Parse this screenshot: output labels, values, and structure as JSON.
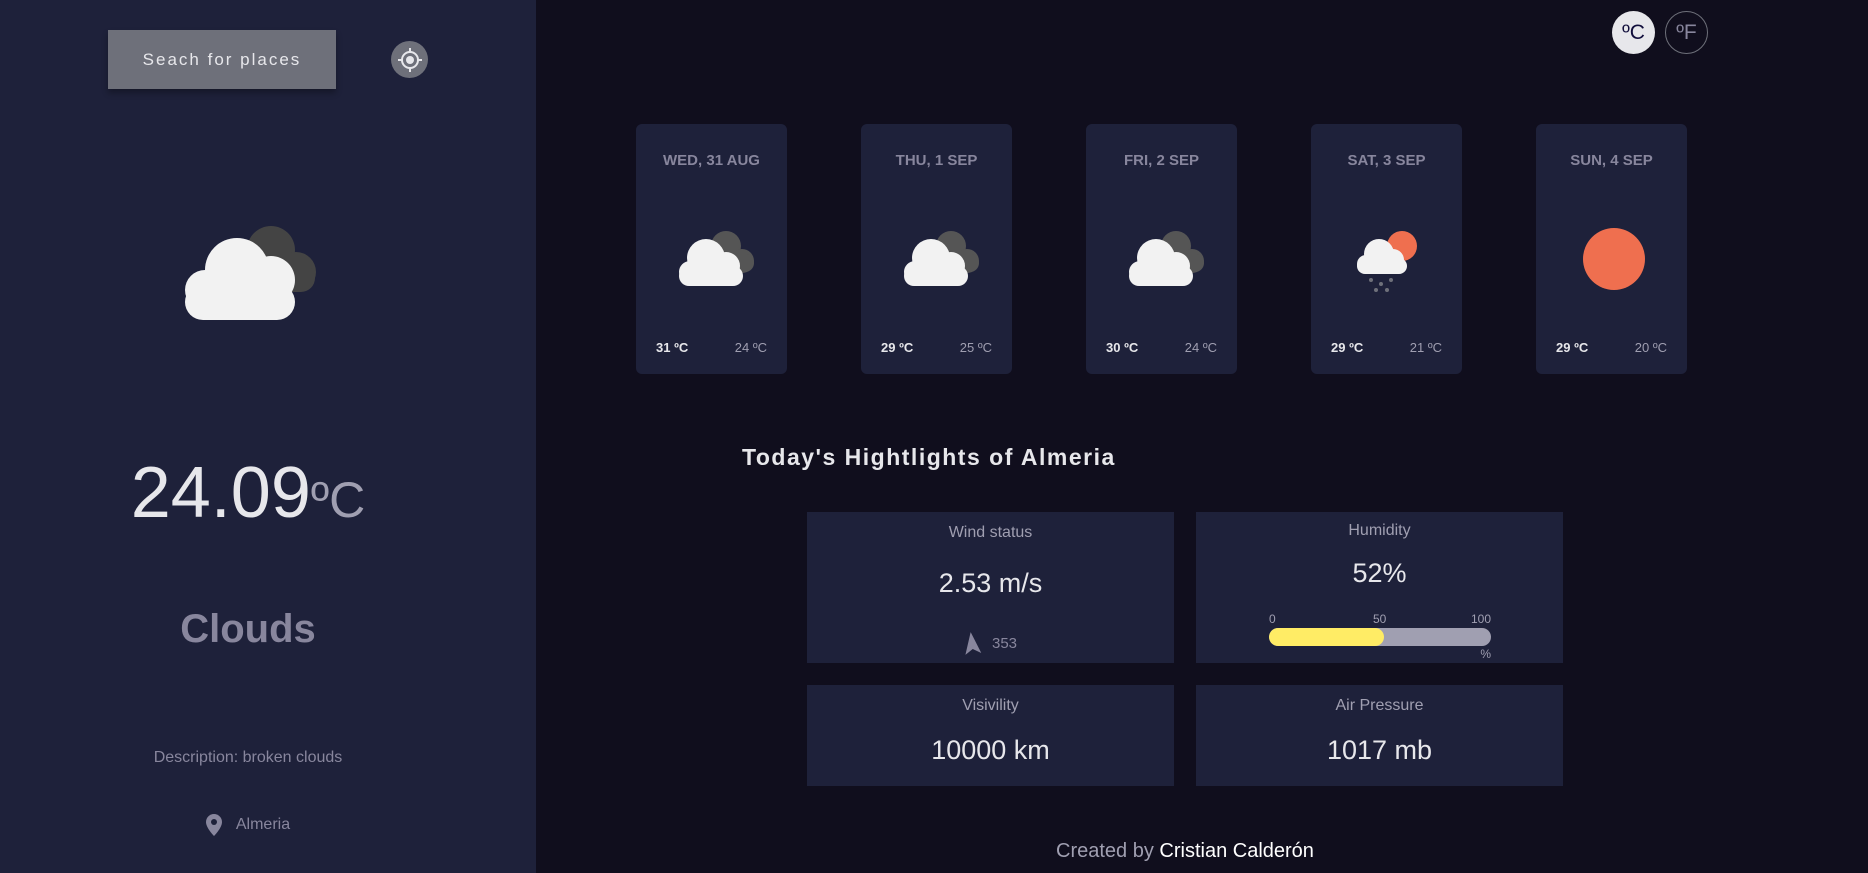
{
  "sidebar": {
    "search_label": "Seach for places",
    "main_icon": "cloud-icon",
    "temp_value": "24.09",
    "temp_unit": "ºC",
    "condition": "Clouds",
    "description": "Description: broken clouds",
    "location": "Almeria"
  },
  "units": {
    "celsius": "ºC",
    "fahrenheit": "ºF",
    "selected": "celsius"
  },
  "forecast": [
    {
      "date": "WED, 31 AUG",
      "icon": "cloud-icon",
      "max": "31 ºC",
      "min": "24 ºC"
    },
    {
      "date": "THU, 1 SEP",
      "icon": "cloud-icon",
      "max": "29 ºC",
      "min": "25 ºC"
    },
    {
      "date": "FRI, 2 SEP",
      "icon": "cloud-icon",
      "max": "30 ºC",
      "min": "24 ºC"
    },
    {
      "date": "SAT, 3 SEP",
      "icon": "light-rain-icon",
      "max": "29 ºC",
      "min": "21 ºC"
    },
    {
      "date": "SUN, 4 SEP",
      "icon": "sun-icon",
      "max": "29 ºC",
      "min": "20 ºC"
    }
  ],
  "highlights": {
    "title": "Today's Hightlights of Almeria",
    "wind": {
      "label": "Wind status",
      "value": "2.53 m/s",
      "direction": "353"
    },
    "humidity": {
      "label": "Humidity",
      "value": "52%",
      "percent": 52,
      "scale_0": "0",
      "scale_50": "50",
      "scale_100": "100",
      "scale_unit": "%"
    },
    "visibility": {
      "label": "Visivility",
      "value": "10000 km"
    },
    "pressure": {
      "label": "Air Pressure",
      "value": "1017 mb"
    }
  },
  "footer": {
    "prefix": "Created by",
    "author": "Cristian Calderón"
  },
  "colors": {
    "sidebar": "#1e213a",
    "background": "#100e1d",
    "accent_bar": "#ffec65",
    "sun": "#ef6f4f"
  }
}
